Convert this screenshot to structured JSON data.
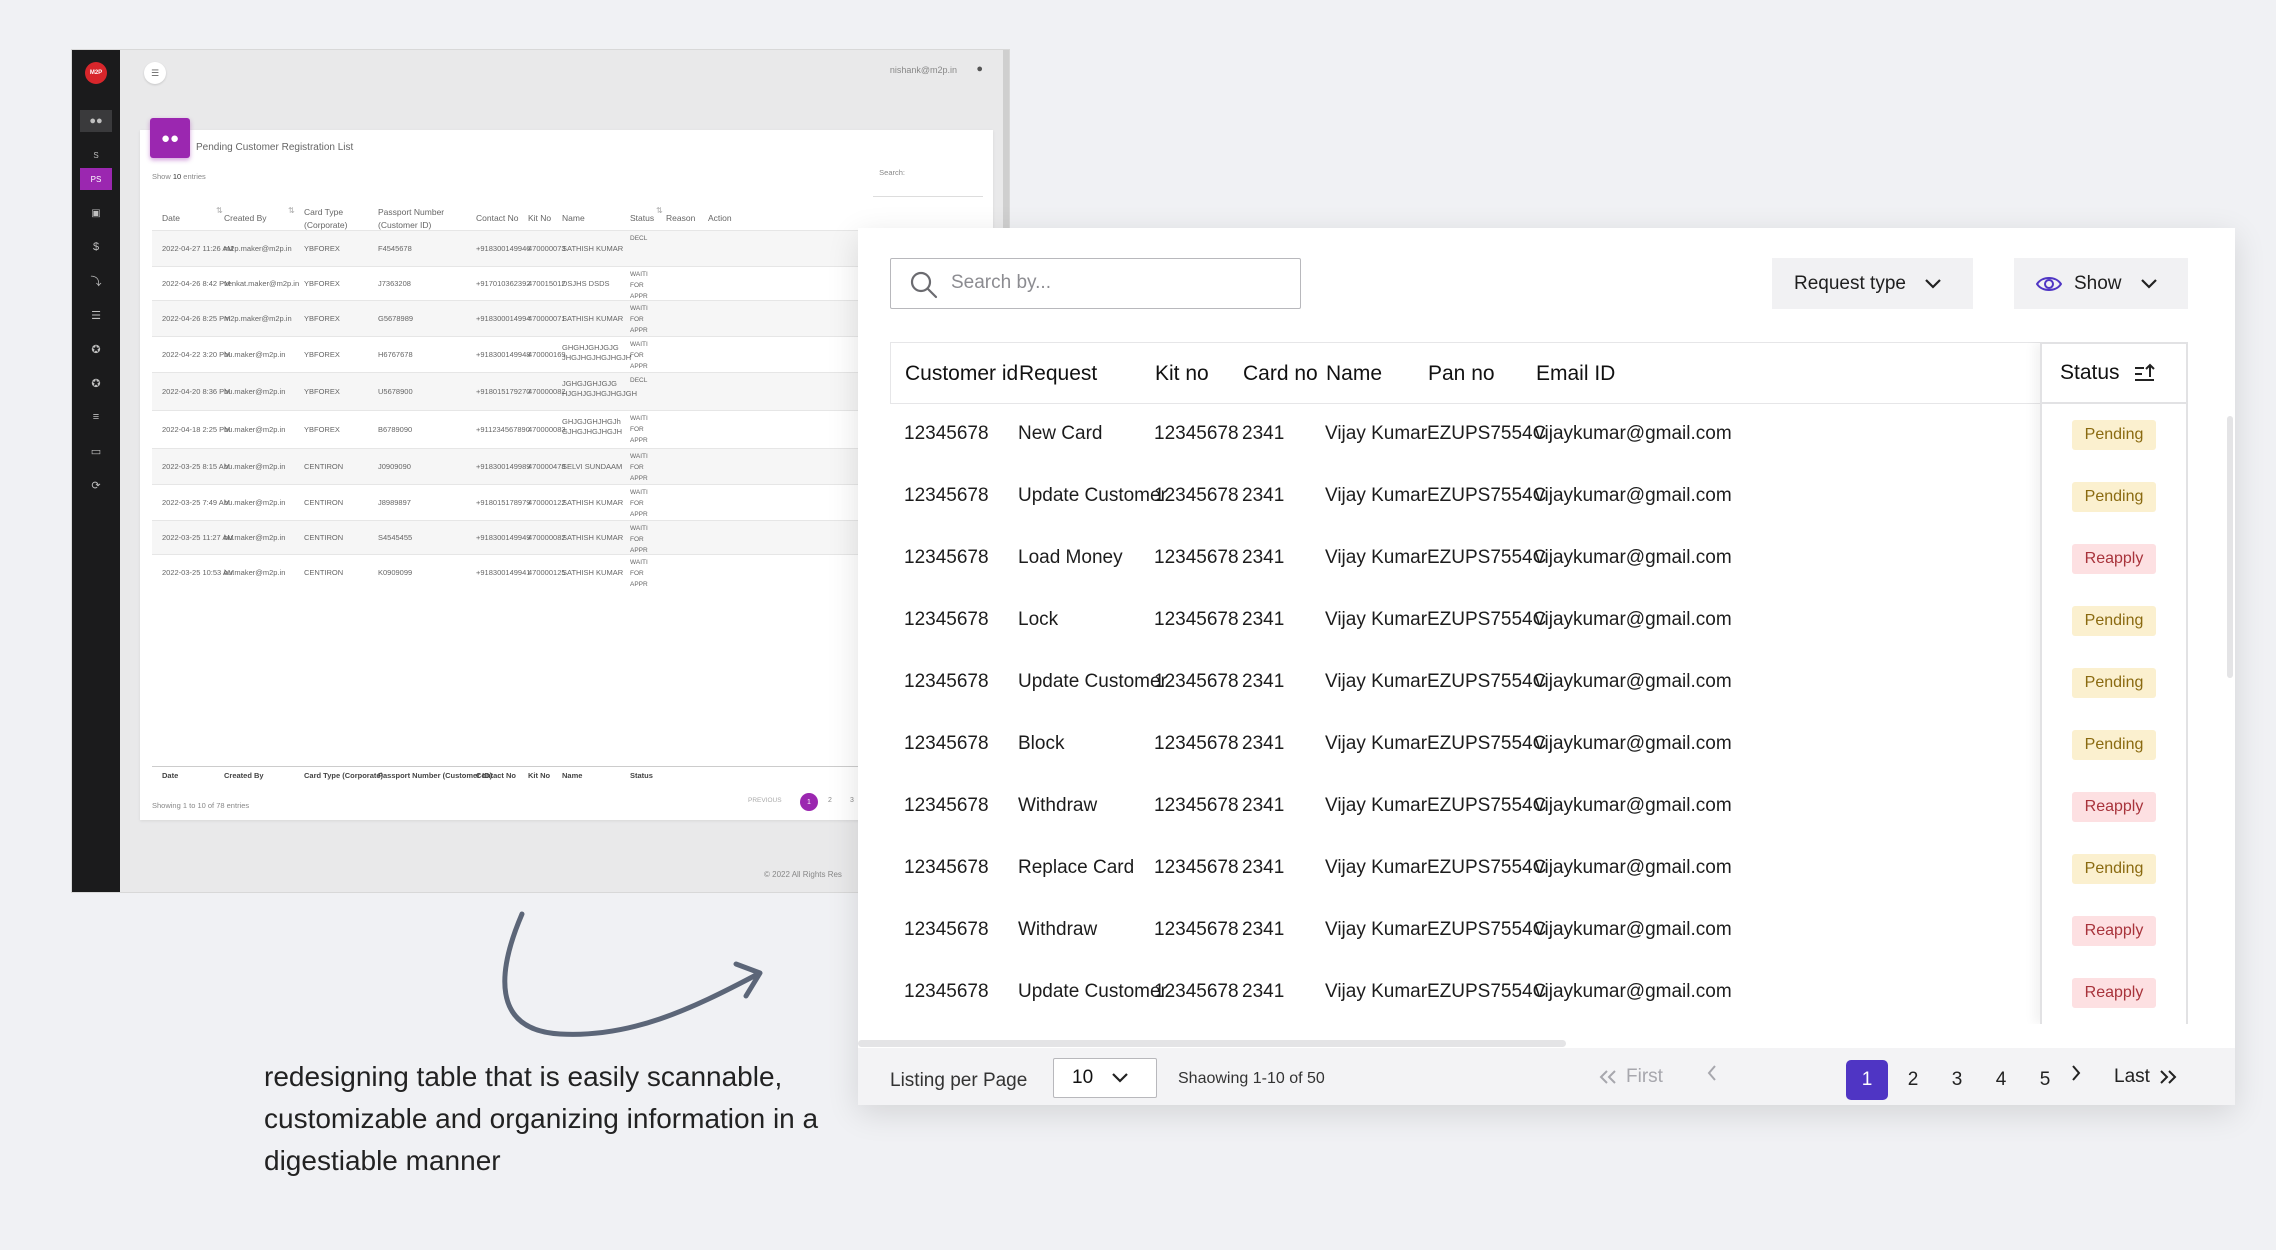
{
  "old_ui": {
    "logo": "M2P",
    "user_email": "nishank@m2p.in",
    "sidebar_items": [
      "users",
      "S",
      "PS",
      "image",
      "$",
      "person-down",
      "list",
      "person",
      "person",
      "list-check",
      "file",
      "refresh"
    ],
    "title": "Pending Customer Registration List",
    "show_prefix": "Show",
    "show_value": "10",
    "show_suffix": "entries",
    "search_label": "Search:",
    "headers": [
      "Date",
      "Created By",
      "Card Type (Corporate)",
      "Passport Number (Customer ID)",
      "Contact No",
      "Kit No",
      "Name",
      "Status",
      "Reason",
      "Action"
    ],
    "footer_headers": [
      "Date",
      "Created By",
      "Card Type (Corporate)",
      "Passport Number (Customer ID)",
      "Contact No",
      "Kit No",
      "Name",
      "Status"
    ],
    "rows": [
      {
        "date": "2022-04-27 11:26 AM",
        "by": "m2p.maker@m2p.in",
        "card": "YBFOREX",
        "passport": "F4545678",
        "contact": "+918300149946",
        "kit": "470000073",
        "name": "SATHISH KUMAR",
        "status": "DECL"
      },
      {
        "date": "2022-04-26 8:42 PM",
        "by": "venkat.maker@m2p.in",
        "card": "YBFOREX",
        "passport": "J7363208",
        "contact": "+917010362392",
        "kit": "470015012",
        "name": "DSJHS DSDS",
        "status": "WAITI FOR APPR"
      },
      {
        "date": "2022-04-26 8:25 PM",
        "by": "m2p.maker@m2p.in",
        "card": "YBFOREX",
        "passport": "G5678989",
        "contact": "+918300014994",
        "kit": "470000071",
        "name": "SATHISH KUMAR",
        "status": "WAITI FOR APPR"
      },
      {
        "date": "2022-04-22 3:20 PM",
        "by": "bu.maker@m2p.in",
        "card": "YBFOREX",
        "passport": "H6767678",
        "contact": "+918300149948",
        "kit": "470000169",
        "name": "GHGHJGHJGJG JHGJHGJHGJHGJH",
        "status": "WAITI FOR APPR"
      },
      {
        "date": "2022-04-20 8:36 PM",
        "by": "bu.maker@m2p.in",
        "card": "YBFOREX",
        "passport": "U5678900",
        "contact": "+918015179270",
        "kit": "470000082",
        "name": "JGHGJGHJGJG HJGHJGJHGJHGJGH",
        "status": "DECL"
      },
      {
        "date": "2022-04-18 2:25 PM",
        "by": "bu.maker@m2p.in",
        "card": "YBFOREX",
        "passport": "B6789090",
        "contact": "+911234567890",
        "kit": "470000083",
        "name": "GHJGJGHJHGJh GJHGJHGJHGJH",
        "status": "WAITI FOR APPR"
      },
      {
        "date": "2022-03-25 8:15 AM",
        "by": "bu.maker@m2p.in",
        "card": "CENTIRON",
        "passport": "J0909090",
        "contact": "+918300149989",
        "kit": "470000478",
        "name": "SELVI SUNDAAM",
        "status": "WAITI FOR APPR"
      },
      {
        "date": "2022-03-25 7:49 AM",
        "by": "bu.maker@m2p.in",
        "card": "CENTIRON",
        "passport": "J8989897",
        "contact": "+918015178979",
        "kit": "470000122",
        "name": "SATHISH KUMAR",
        "status": "WAITI FOR APPR"
      },
      {
        "date": "2022-03-25 11:27 AM",
        "by": "bu.maker@m2p.in",
        "card": "CENTIRON",
        "passport": "S4545455",
        "contact": "+918300149949",
        "kit": "470000082",
        "name": "SATHISH KUMAR",
        "status": "WAITI FOR APPR"
      },
      {
        "date": "2022-03-25 10:53 AM",
        "by": "bu.maker@m2p.in",
        "card": "CENTIRON",
        "passport": "K0909099",
        "contact": "+918300149941",
        "kit": "470000125",
        "name": "SATHISH KUMAR",
        "status": "WAITI FOR APPR"
      }
    ],
    "showing": "Showing 1 to 10 of 78 entries",
    "pagination": {
      "previous": "PREVIOUS",
      "pages": [
        "1",
        "2",
        "3"
      ]
    },
    "copyright": "© 2022 All Rights Res"
  },
  "caption": "redesigning table that is easily scannable, customizable and organizing information in a digestiable manner",
  "new_ui": {
    "search_placeholder": "Search by...",
    "request_type_label": "Request type",
    "show_label": "Show",
    "columns": [
      "Customer id",
      "Request",
      "Kit no",
      "Card no",
      "Name",
      "Pan no",
      "Email ID"
    ],
    "status_header": "Status",
    "rows": [
      {
        "customer_id": "12345678",
        "request": "New Card",
        "kit_no": "12345678",
        "card_no": "2341",
        "name": "Vijay Kumar",
        "pan_no": "EZUPS7554C",
        "email": "vijaykumar@gmail.com",
        "status": "Pending"
      },
      {
        "customer_id": "12345678",
        "request": "Update Customer",
        "kit_no": "12345678",
        "card_no": "2341",
        "name": "Vijay Kumar",
        "pan_no": "EZUPS7554C",
        "email": "vijaykumar@gmail.com",
        "status": "Pending"
      },
      {
        "customer_id": "12345678",
        "request": "Load Money",
        "kit_no": "12345678",
        "card_no": "2341",
        "name": "Vijay Kumar",
        "pan_no": "EZUPS7554C",
        "email": "vijaykumar@gmail.com",
        "status": "Reapply"
      },
      {
        "customer_id": "12345678",
        "request": "Lock",
        "kit_no": "12345678",
        "card_no": "2341",
        "name": "Vijay Kumar",
        "pan_no": "EZUPS7554C",
        "email": "vijaykumar@gmail.com",
        "status": "Pending"
      },
      {
        "customer_id": "12345678",
        "request": "Update Customer",
        "kit_no": "12345678",
        "card_no": "2341",
        "name": "Vijay Kumar",
        "pan_no": "EZUPS7554C",
        "email": "vijaykumar@gmail.com",
        "status": "Pending"
      },
      {
        "customer_id": "12345678",
        "request": "Block",
        "kit_no": "12345678",
        "card_no": "2341",
        "name": "Vijay Kumar",
        "pan_no": "EZUPS7554C",
        "email": "vijaykumar@gmail.com",
        "status": "Pending"
      },
      {
        "customer_id": "12345678",
        "request": "Withdraw",
        "kit_no": "12345678",
        "card_no": "2341",
        "name": "Vijay Kumar",
        "pan_no": "EZUPS7554C",
        "email": "vijaykumar@gmail.com",
        "status": "Reapply"
      },
      {
        "customer_id": "12345678",
        "request": "Replace Card",
        "kit_no": "12345678",
        "card_no": "2341",
        "name": "Vijay Kumar",
        "pan_no": "EZUPS7554C",
        "email": "vijaykumar@gmail.com",
        "status": "Pending"
      },
      {
        "customer_id": "12345678",
        "request": "Withdraw",
        "kit_no": "12345678",
        "card_no": "2341",
        "name": "Vijay Kumar",
        "pan_no": "EZUPS7554C",
        "email": "vijaykumar@gmail.com",
        "status": "Reapply"
      },
      {
        "customer_id": "12345678",
        "request": "Update Customer",
        "kit_no": "12345678",
        "card_no": "2341",
        "name": "Vijay Kumar",
        "pan_no": "EZUPS7554C",
        "email": "vijaykumar@gmail.com",
        "status": "Reapply"
      }
    ],
    "listing_label": "Listing per Page",
    "per_page_value": "10",
    "showing_text": "Shaowing 1-10 of 50",
    "pagination": {
      "first": "First",
      "pages": [
        "1",
        "2",
        "3",
        "4",
        "5"
      ],
      "active_page": "1",
      "last": "Last"
    },
    "colors": {
      "accent": "#4f35c4",
      "pending_bg": "#fbf0cf",
      "pending_text": "#8a6a10",
      "reapply_bg": "#fde0e2",
      "reapply_text": "#a8333b",
      "old_accent": "#9b27b0",
      "old_logo": "#d8262b"
    }
  }
}
